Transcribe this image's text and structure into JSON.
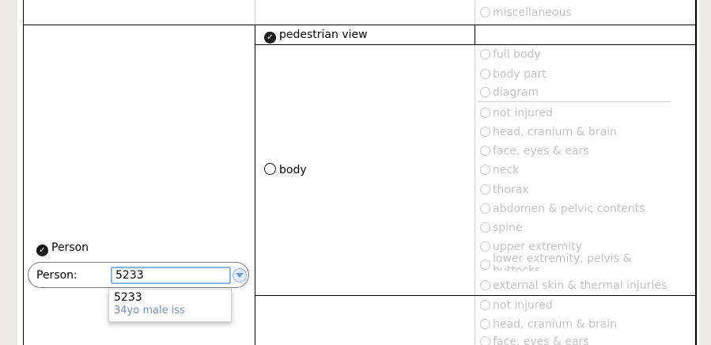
{
  "top_partial": {
    "option": "miscellaneous"
  },
  "pedestrian_view": {
    "label": "pedestrian view",
    "checked": true
  },
  "body": {
    "label": "body",
    "checked": false
  },
  "body_options_group1": [
    "full body",
    "body part",
    "diagram"
  ],
  "body_options_group2": [
    "not injured",
    "head, cranium & brain",
    "face, eyes & ears",
    "neck",
    "thorax",
    "abdomen & pelvic contents",
    "spine",
    "upper extremity",
    "lower extremity, pelvis & buttocks",
    "external skin & thermal injuries"
  ],
  "bottom_options": [
    "not injured",
    "head, cranium & brain",
    "face, eyes & ears"
  ],
  "person": {
    "checkbox_label": "Person",
    "field_label": "Person:",
    "value": "5233",
    "suggestion_id": "5233",
    "suggestion_desc": "34yo male iss"
  },
  "colors": {
    "checked_fill": "#1a1a1a",
    "disabled_text": "#c4c4c4",
    "focus_ring": "#8fb4ea",
    "suggestion_desc": "#7a90b8"
  }
}
